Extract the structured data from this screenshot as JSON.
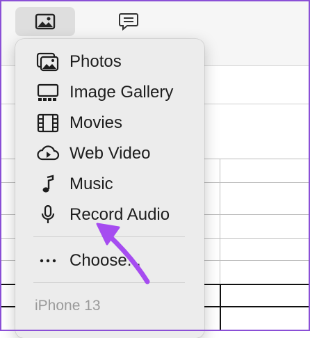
{
  "toolbar": {
    "media_icon": "photo-icon",
    "comment_icon": "comment-icon"
  },
  "menu": {
    "items": [
      {
        "label": "Photos",
        "icon": "photos-icon"
      },
      {
        "label": "Image Gallery",
        "icon": "image-gallery-icon"
      },
      {
        "label": "Movies",
        "icon": "film-icon"
      },
      {
        "label": "Web Video",
        "icon": "cloud-play-icon"
      },
      {
        "label": "Music",
        "icon": "music-note-icon"
      },
      {
        "label": "Record Audio",
        "icon": "microphone-icon"
      }
    ],
    "choose": {
      "label": "Choose...",
      "icon": "ellipsis-icon"
    },
    "device_section": "iPhone 13"
  },
  "annotation": {
    "color": "#a64cf0",
    "target": "Record Audio"
  },
  "colors": {
    "frame": "#8a4fd6",
    "menu_bg": "#ececec"
  }
}
